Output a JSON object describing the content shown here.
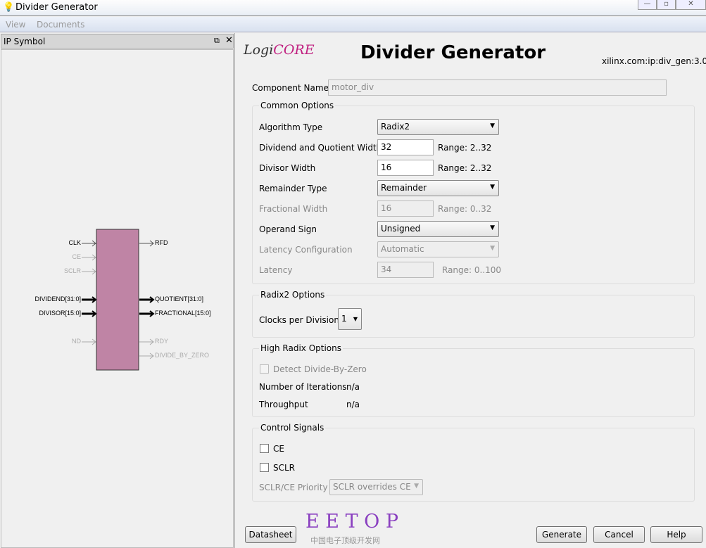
{
  "window": {
    "title": "Divider Generator"
  },
  "menu": [
    "View",
    "Documents"
  ],
  "left_panel": {
    "title": "IP Symbol",
    "pins_in": [
      {
        "label": "CLK",
        "enabled": true
      },
      {
        "label": "CE",
        "enabled": false
      },
      {
        "label": "SCLR",
        "enabled": false
      },
      {
        "label": "DIVIDEND[31:0]",
        "enabled": true,
        "bus": true
      },
      {
        "label": "DIVISOR[15:0]",
        "enabled": true,
        "bus": true
      },
      {
        "label": "ND",
        "enabled": false
      }
    ],
    "pins_out": [
      {
        "label": "RFD",
        "enabled": true
      },
      {
        "label": "QUOTIENT[31:0]",
        "enabled": true,
        "bus": true
      },
      {
        "label": "FRACTIONAL[15:0]",
        "enabled": true,
        "bus": true
      },
      {
        "label": "RDY",
        "enabled": false
      },
      {
        "label": "DIVIDE_BY_ZERO",
        "enabled": false
      }
    ],
    "block_color": "#bf84a5"
  },
  "header": {
    "logo": "LogiCORE",
    "title": "Divider Generator",
    "vlnv": "xilinx.com:ip:div_gen:3.0"
  },
  "component": {
    "label": "Component Name",
    "value": "motor_div"
  },
  "common": {
    "title": "Common Options",
    "algorithm_label": "Algorithm Type",
    "algorithm": "Radix2",
    "dq_width_label": "Dividend and Quotient Width",
    "dq_width": "32",
    "dq_range": "Range: 2..32",
    "divisor_label": "Divisor Width",
    "divisor": "16",
    "divisor_range": "Range: 2..32",
    "remainder_label": "Remainder Type",
    "remainder": "Remainder",
    "frac_label": "Fractional Width",
    "frac": "16",
    "frac_range": "Range: 0..32",
    "sign_label": "Operand Sign",
    "sign": "Unsigned",
    "latcfg_label": "Latency Configuration",
    "latcfg": "Automatic",
    "latency_label": "Latency",
    "latency": "34",
    "latency_range": "Range: 0..100"
  },
  "radix2": {
    "title": "Radix2 Options",
    "clocks_label": "Clocks per Division",
    "clocks": "1"
  },
  "high_radix": {
    "title": "High Radix Options",
    "detect_label": "Detect Divide-By-Zero",
    "iter_label": "Number of Iterations",
    "iter": "n/a",
    "thr_label": "Throughput",
    "thr": "n/a"
  },
  "control": {
    "title": "Control Signals",
    "ce_label": "CE",
    "sclr_label": "SCLR",
    "prio_label": "SCLR/CE Priority",
    "prio": "SCLR overrides CE"
  },
  "footer": {
    "datasheet": "Datasheet",
    "watermark": "E E T O P",
    "watermark_sub": "中国电子顶级开发网",
    "generate": "Generate",
    "cancel": "Cancel",
    "help": "Help"
  }
}
